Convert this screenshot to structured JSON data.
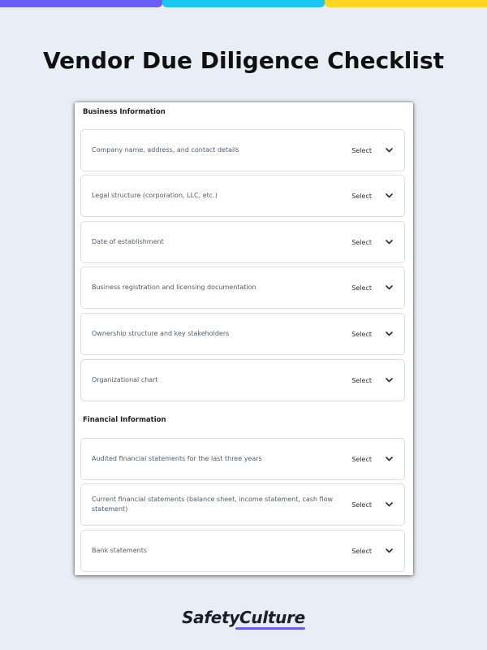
{
  "page": {
    "title": "Vendor Due Diligence Checklist",
    "accent_colors": [
      "#6a5df4",
      "#19c7f0",
      "#ffd61f"
    ],
    "background": "#e8edf6"
  },
  "sections": [
    {
      "heading": "Business Information",
      "items": [
        {
          "label": "Company name, address, and contact details",
          "value": "Select"
        },
        {
          "label": "Legal structure (corporation, LLC, etc.)",
          "value": "Select"
        },
        {
          "label": "Date of establishment",
          "value": "Select"
        },
        {
          "label": "Business registration and licensing documentation",
          "value": "Select"
        },
        {
          "label": "Ownership structure and key stakeholders",
          "value": "Select"
        },
        {
          "label": "Organizational chart",
          "value": "Select"
        }
      ]
    },
    {
      "heading": "Financial Information",
      "items": [
        {
          "label": "Audited financial statements for the last three years",
          "value": "Select"
        },
        {
          "label": "Current financial statements (balance sheet, income statement, cash flow statement)",
          "value": "Select"
        },
        {
          "label": "Bank statements",
          "value": "Select"
        }
      ]
    }
  ],
  "icons": {
    "dropdown": "chevron-down-icon"
  },
  "brand": {
    "logo_text": "SafetyCulture",
    "underline_color": "#6a5df4"
  }
}
